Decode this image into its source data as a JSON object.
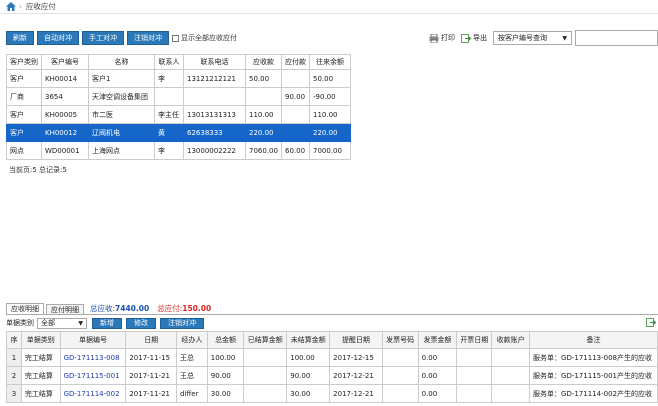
{
  "breadcrumb": {
    "current": "应收应付"
  },
  "toolbar": {
    "refresh": "刷新",
    "auto_offset": "自动对冲",
    "manual_offset": "手工对冲",
    "cancel_offset": "注销对冲",
    "show_all_label": "显示全部应收应付",
    "print": "打印",
    "export": "导出",
    "search_mode": "按客户编号查询",
    "search_value": ""
  },
  "main_table": {
    "headers": [
      "客户类别",
      "客户编号",
      "名称",
      "联系人",
      "联系电话",
      "应收款",
      "应付款",
      "往来余额"
    ],
    "rows": [
      [
        "客户",
        "KH00014",
        "客户1",
        "李",
        "13121212121",
        "50.00",
        "",
        "50.00"
      ],
      [
        "厂商",
        "3654",
        "天津空调设备集团",
        "",
        "",
        "",
        "90.00",
        "-90.00"
      ],
      [
        "客户",
        "KH00005",
        "市二医",
        "李主任",
        "13013131313",
        "110.00",
        "",
        "110.00"
      ],
      [
        "客户",
        "KH00012",
        "辽阀机电",
        "黄",
        "62638333",
        "220.00",
        "",
        "220.00"
      ],
      [
        "网点",
        "WD00001",
        "上海网点",
        "李",
        "13000002222",
        "7060.00",
        "60.00",
        "7000.00"
      ]
    ],
    "selected_row": 3
  },
  "pager": {
    "text": "当前页:5  总记录:5"
  },
  "tabs": [
    {
      "label": "应收明细",
      "active": true
    },
    {
      "label": "应付明细",
      "active": false
    }
  ],
  "totals": {
    "receivable_label": "总应收:",
    "receivable_value": "7440.00",
    "payable_label": "总应付:",
    "payable_value": "150.00"
  },
  "sub_toolbar": {
    "type_label": "单据类别",
    "type_value": "全部",
    "add": "新增",
    "edit": "修改",
    "cancel_offset": "注销对冲"
  },
  "detail_table": {
    "headers": [
      "序",
      "单据类别",
      "单据编号",
      "日期",
      "经办人",
      "总金额",
      "已结算金额",
      "未结算金额",
      "提醒日期",
      "发票号码",
      "发票金额",
      "开票日期",
      "收款账户",
      "备注"
    ],
    "rows": [
      [
        "1",
        "完工结算",
        "GD-171113-008",
        "2017-11-15",
        "王总",
        "100.00",
        "",
        "100.00",
        "2017-12-15",
        "",
        "0.00",
        "",
        "",
        "服务单：GD-171113-008产生的应收"
      ],
      [
        "2",
        "完工结算",
        "GD-171115-001",
        "2017-11-21",
        "王总",
        "90.00",
        "",
        "90.00",
        "2017-12-21",
        "",
        "0.00",
        "",
        "",
        "服务单：GD-171115-001产生的应收"
      ],
      [
        "3",
        "完工结算",
        "GD-171114-002",
        "2017-11-21",
        "differ",
        "30.00",
        "",
        "30.00",
        "2017-12-21",
        "",
        "0.00",
        "",
        "",
        "服务单：GD-171114-002产生的应收"
      ]
    ]
  },
  "colors": {
    "button": "#2b79b9",
    "selected_row": "#1466c8",
    "receivable": "#1a4fb3",
    "payable": "#dd2222"
  }
}
